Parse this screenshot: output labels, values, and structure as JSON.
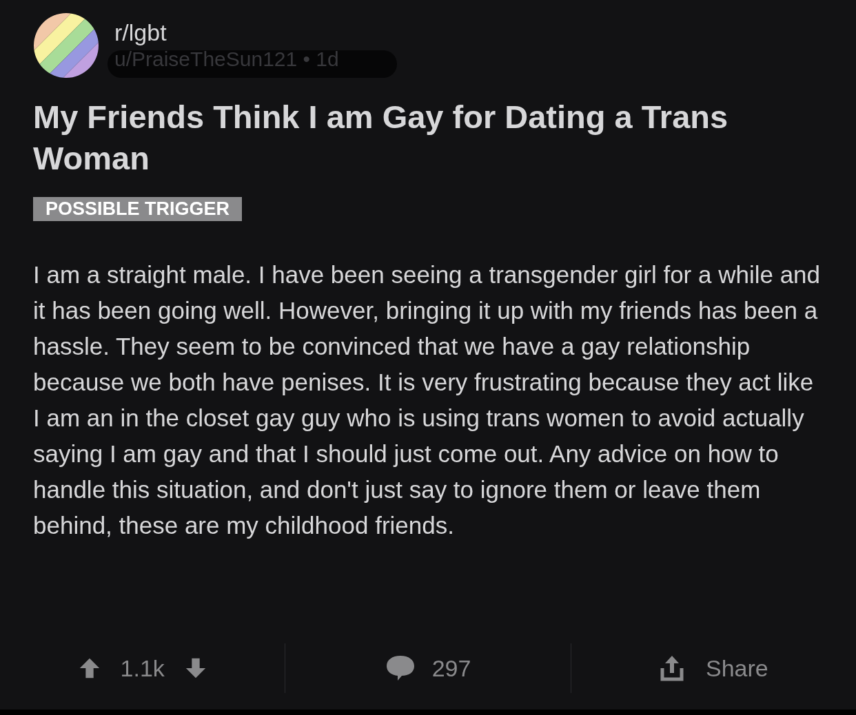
{
  "post": {
    "subreddit": "r/lgbt",
    "byline": "u/PraiseTheSun121 • 1d",
    "title": "My Friends Think I am Gay for Dating a Trans Woman",
    "flair": "POSSIBLE TRIGGER",
    "body": "I am a straight male. I have been seeing a transgender girl for a while and it has been going well. However, bringing it up with my friends has been a hassle. They seem to be convinced that we have a gay relationship because we both have penises. It is very frustrating because they act like I am an in the closet gay guy who is using trans women to avoid actually saying I am gay and that I should just come out. Any advice on how to handle this situation, and don't just say to ignore them or leave them behind, these are my childhood friends."
  },
  "actions": {
    "score": "1.1k",
    "comments": "297",
    "share": "Share"
  }
}
